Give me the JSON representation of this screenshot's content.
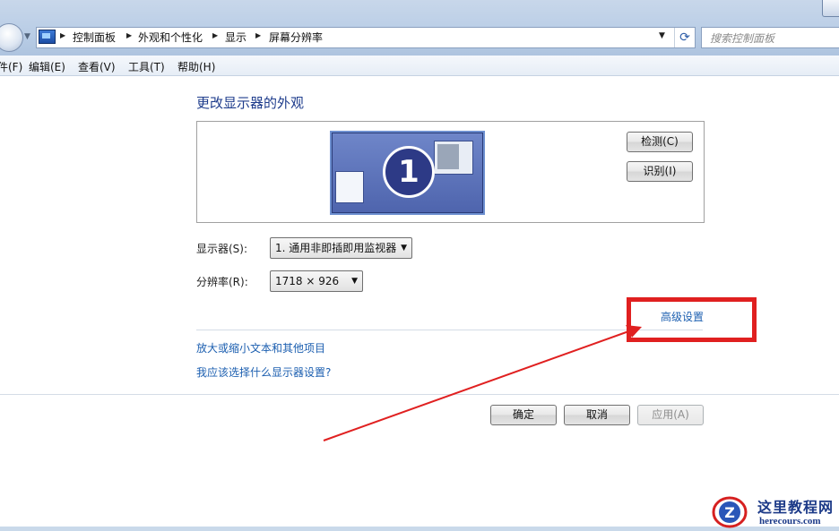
{
  "address": {
    "breadcrumbs": [
      "控制面板",
      "外观和个性化",
      "显示",
      "屏幕分辨率"
    ],
    "search_placeholder": "搜索控制面板"
  },
  "menu": [
    "件(F)",
    "编辑(E)",
    "查看(V)",
    "工具(T)",
    "帮助(H)"
  ],
  "main": {
    "heading": "更改显示器的外观",
    "monitor_number": "1",
    "detect_label": "检测(C)",
    "identify_label": "识别(I)",
    "display_label": "显示器(S):",
    "display_value": "1. 通用非即插即用监视器",
    "resolution_label": "分辨率(R):",
    "resolution_value": "1718 × 926",
    "advanced_link": "高级设置",
    "link_text_size": "放大或缩小文本和其他项目",
    "link_which_settings": "我应该选择什么显示器设置?"
  },
  "buttons": {
    "ok": "确定",
    "cancel": "取消",
    "apply": "应用(A)"
  },
  "annotation": {
    "color": "#e02020"
  },
  "watermark": {
    "title": "这里教程网",
    "url": "herecours.com"
  }
}
